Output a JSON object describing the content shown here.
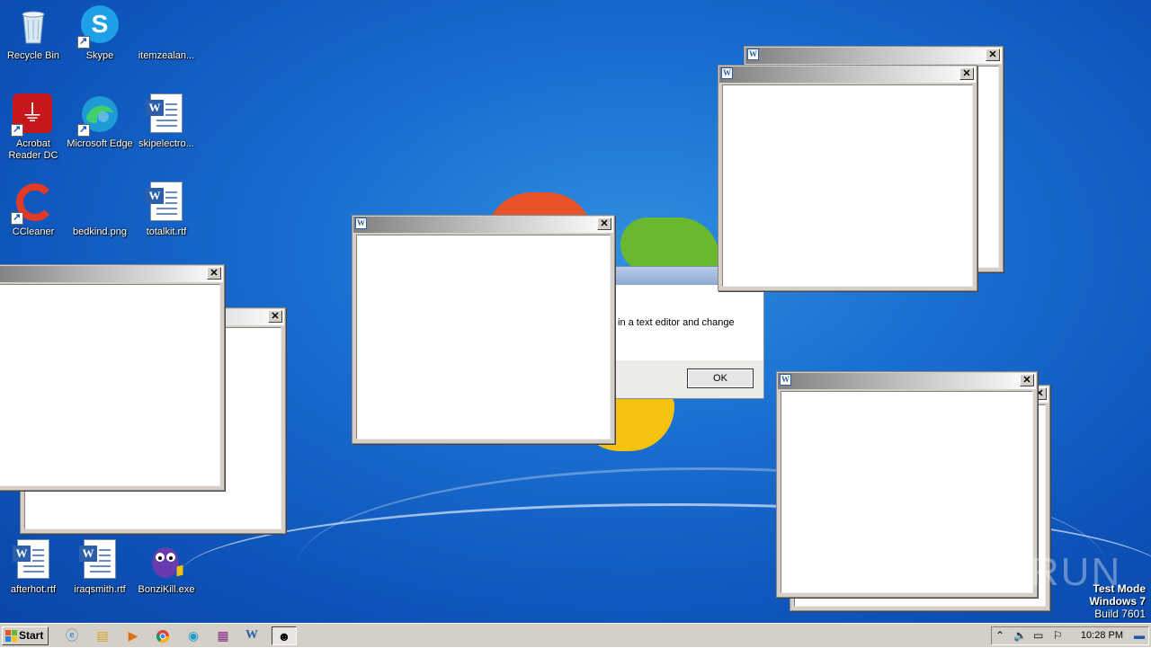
{
  "desktop_icons": [
    {
      "label": "Recycle Bin",
      "icon": "recycle-bin-icon"
    },
    {
      "label": "Skype",
      "icon": "skype-icon"
    },
    {
      "label": "itemzealan...",
      "icon": "file-icon"
    },
    {
      "label": "Acrobat Reader DC",
      "icon": "acrobat-icon"
    },
    {
      "label": "Microsoft Edge",
      "icon": "edge-icon"
    },
    {
      "label": "skipelectro...",
      "icon": "word-doc-icon"
    },
    {
      "label": "CCleaner",
      "icon": "ccleaner-icon"
    },
    {
      "label": "bedkind.png",
      "icon": "image-file-icon"
    },
    {
      "label": "totalkit.rtf",
      "icon": "word-doc-icon"
    },
    {
      "label": "afterhot.rtf",
      "icon": "word-doc-icon"
    },
    {
      "label": "iraqsmith.rtf",
      "icon": "word-doc-icon"
    },
    {
      "label": "BonziKill.exe",
      "icon": "bonzi-icon"
    }
  ],
  "message_box": {
    "text": "in a text editor and change",
    "ok_label": "OK"
  },
  "windows": {
    "close_glyph": "✕",
    "app_icon_glyph": "W"
  },
  "taskbar": {
    "start_label": "Start",
    "clock": "10:28 PM",
    "pinned": [
      "ie-icon",
      "explorer-icon",
      "media-player-icon",
      "chrome-icon",
      "edge-icon",
      "winrar-icon",
      "word-icon",
      "bonzi-taskbar-icon"
    ]
  },
  "watermark": {
    "anyrun": "ANY RUN",
    "test_mode": "Test Mode",
    "os": "Windows 7",
    "build": "Build 7601"
  }
}
